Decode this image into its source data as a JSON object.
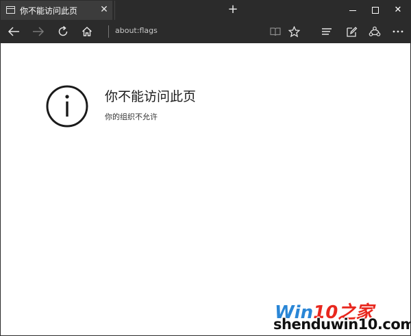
{
  "tab": {
    "title": "你不能访问此页",
    "close_glyph": "✕",
    "new_tab_glyph": "+"
  },
  "window_controls": {
    "close_glyph": "✕"
  },
  "navbar": {
    "address": "about:flags"
  },
  "page": {
    "heading": "你不能访问此页",
    "message": "你的组织不允许"
  },
  "watermark": {
    "brand_win": "Win",
    "brand_ten": "10",
    "brand_wen": "之家",
    "brand_url": "shenduwin10.com"
  },
  "colors": {
    "chrome": "#2b2b2b",
    "active_tab": "#3c3c3c",
    "brand_blue": "#2a86d6",
    "brand_red": "#e8271e"
  }
}
